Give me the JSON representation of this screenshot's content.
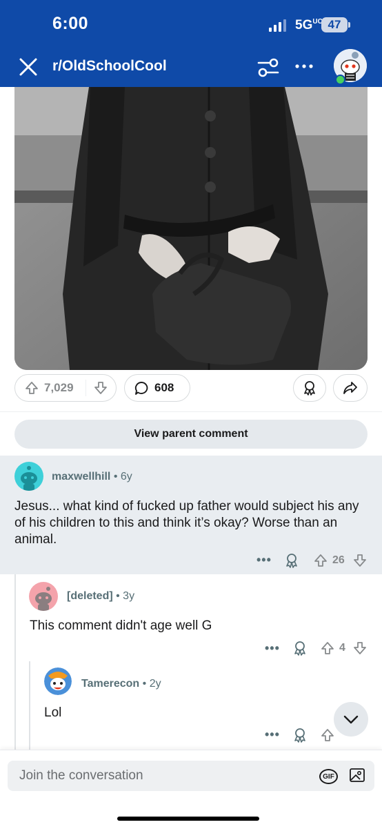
{
  "status_bar": {
    "time": "6:00",
    "network": "5G",
    "network_sup": "UC",
    "battery": "47"
  },
  "header": {
    "subreddit": "r/OldSchoolCool"
  },
  "post": {
    "score": "7,029",
    "comments": "608"
  },
  "view_parent_label": "View parent comment",
  "comments": [
    {
      "author": "maxwellhill",
      "age": "6y",
      "body": "Jesus... what kind of fucked up father would subject his any of his children to this and think it’s okay? Worse than an animal.",
      "score": "26",
      "highlighted": true
    },
    {
      "author": "[deleted]",
      "age": "3y",
      "body": "This comment didn't age well G",
      "score": "4"
    },
    {
      "author": "Tamerecon",
      "age": "2y",
      "body": "Lol",
      "score": ""
    }
  ],
  "composer": {
    "placeholder": "Join the conversation",
    "gif_label": "GIF"
  },
  "colors": {
    "header_bg": "#0f4aa8",
    "highlight_bg": "#e9edf1",
    "online": "#46d160"
  }
}
